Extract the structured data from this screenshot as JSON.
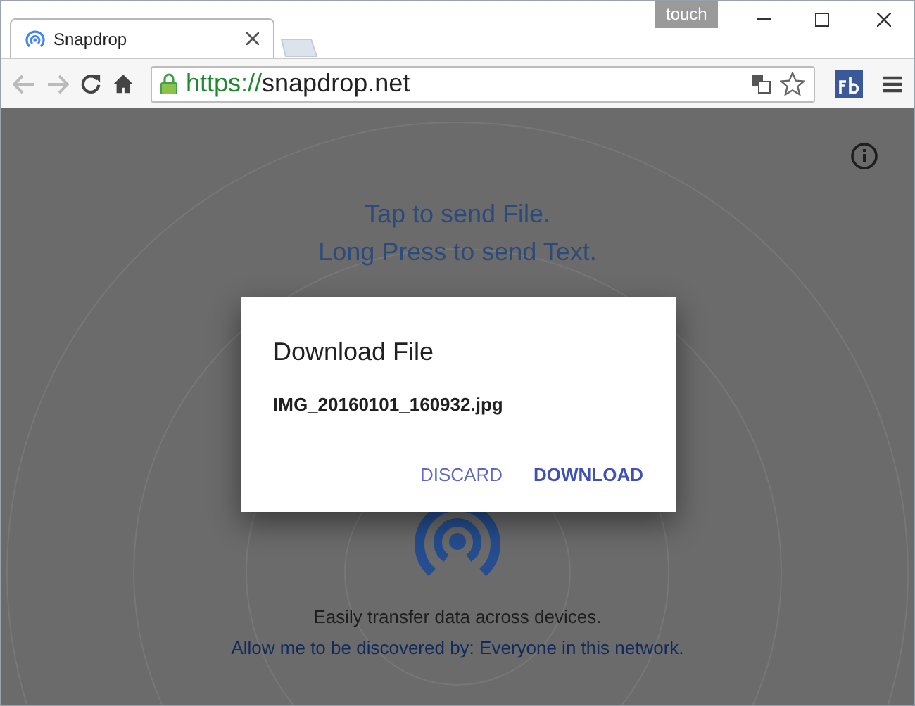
{
  "window": {
    "touch_label": "touch"
  },
  "tabs": [
    {
      "title": "Snapdrop",
      "selected": true
    }
  ],
  "address_bar": {
    "scheme": "https://",
    "host": "snapdrop.net"
  },
  "page": {
    "instructions": [
      "Tap to send File.",
      "Long Press to send Text."
    ],
    "tagline": "Easily transfer data across devices.",
    "discovery_link": "Allow me to be discovered by: Everyone in this network."
  },
  "dialog": {
    "title": "Download File",
    "filename": "IMG_20160101_160932.jpg",
    "buttons": [
      {
        "label": "DISCARD",
        "primary": false
      },
      {
        "label": "DOWNLOAD",
        "primary": true
      }
    ]
  }
}
